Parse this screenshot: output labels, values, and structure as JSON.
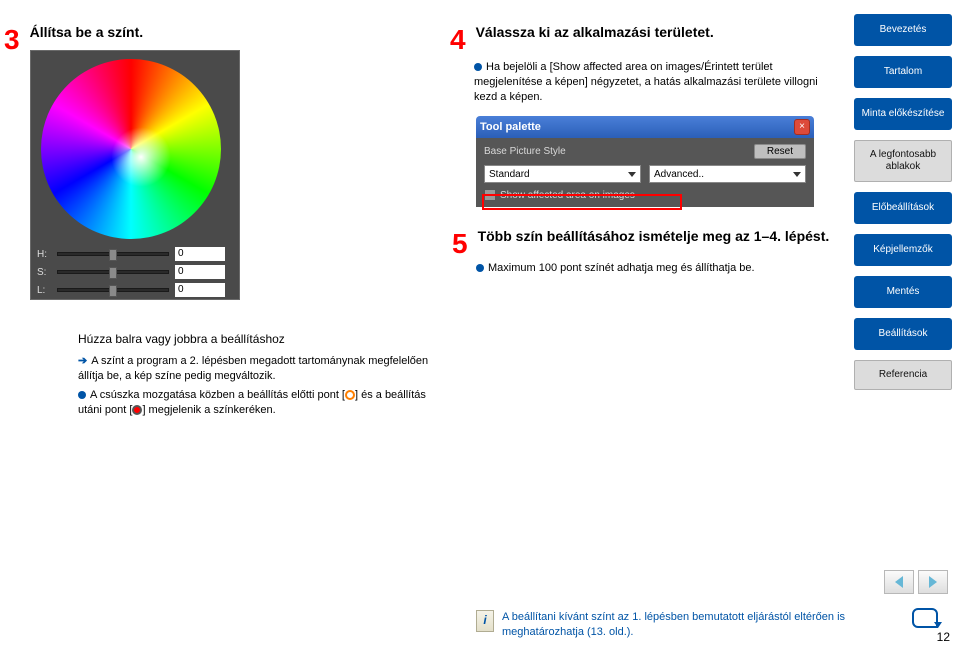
{
  "steps": {
    "s3": {
      "num": "3",
      "title": "Állítsa be a színt."
    },
    "s4": {
      "num": "4",
      "title": "Válassza ki az alkalmazási területet.",
      "body": "Ha bejelöli a [Show affected area on images/Érintett terület megjelenítése a képen] négyzetet, a hatás alkalmazási területe villogni kezd a képen."
    },
    "s5": {
      "num": "5",
      "title": "Több szín beállításához ismételje meg az 1–4. lépést.",
      "body": "Maximum 100 pont színét adhatja meg és állíthatja be."
    }
  },
  "hsl": {
    "H": {
      "label": "H:",
      "value": "0"
    },
    "S": {
      "label": "S:",
      "value": "0"
    },
    "L": {
      "label": "L:",
      "value": "0"
    }
  },
  "tool_palette": {
    "title": "Tool palette",
    "base_label": "Base Picture Style",
    "reset": "Reset",
    "sel1": "Standard",
    "sel2": "Advanced..",
    "checkbox_label": "Show affected area on images"
  },
  "slider_note": {
    "title": "Húzza balra vagy jobbra a beállításhoz",
    "line1a": "A színt a program a 2. lépésben megadott tartománynak megfelelően állítja be, a kép színe pedig megváltozik.",
    "line2a": "A csúszka mozgatása közben a beállítás előtti pont [",
    "line2b": "] és a beállítás utáni pont [",
    "line2c": "] megjelenik a színkeréken."
  },
  "sidebar": {
    "intro": "Bevezetés",
    "toc": "Tartalom",
    "sample": "Minta előkészítése",
    "windows": "A legfontosabb ablakok",
    "presets": "Előbeállítások",
    "chars": "Képjellemzők",
    "save": "Mentés",
    "settings": "Beállítások",
    "ref": "Referencia"
  },
  "tip": {
    "text_a": "A beállítani kívánt színt az 1. lépésben bemutatott eljárástól eltérően is meghatározhatja ",
    "link": "(13. old.)",
    "text_b": "."
  },
  "page_num": "12"
}
